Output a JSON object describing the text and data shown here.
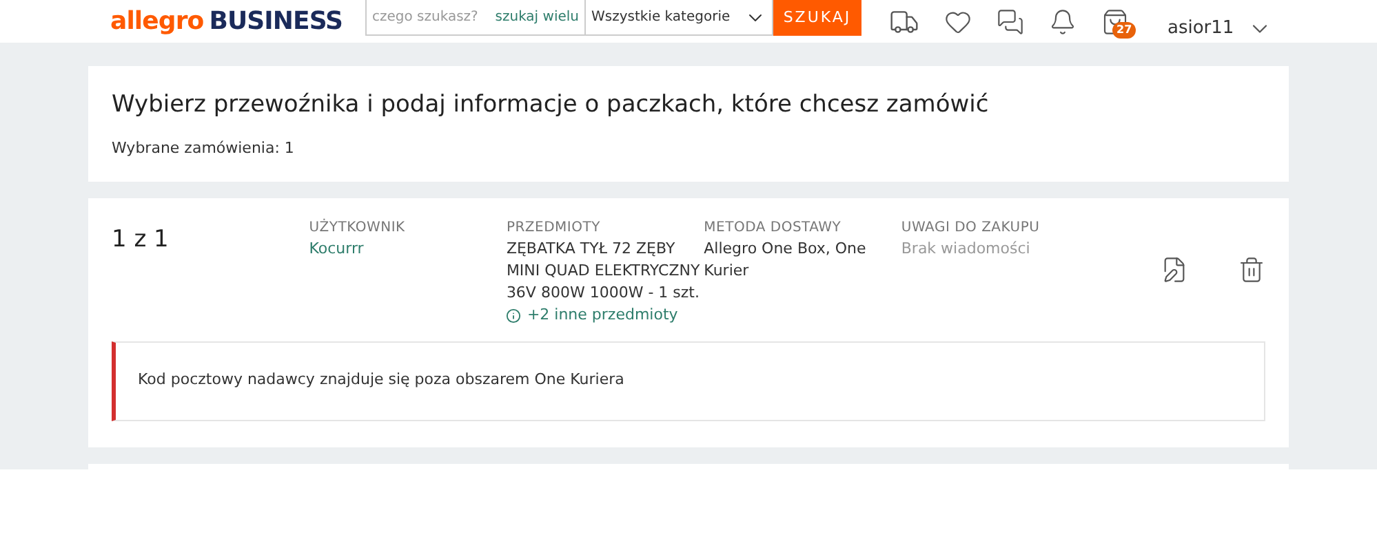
{
  "header": {
    "logo_left": "allegro",
    "logo_right": "BUSINESS",
    "search": {
      "placeholder": "czego szukasz?",
      "link": "szukaj wielu",
      "category": "Wszystkie kategorie",
      "button": "SZUKAJ"
    },
    "cart_badge": "27",
    "username": "asior11"
  },
  "intro": {
    "title": "Wybierz przewoźnika i podaj informacje o paczkach, które chcesz zamówić",
    "selected_orders": "Wybrane zamówienia: 1"
  },
  "order": {
    "counter": "1 z 1",
    "columns": [
      {
        "label": "UŻYTKOWNIK",
        "kind": "link",
        "lines": [
          "Kocurrr"
        ]
      },
      {
        "label": "PRZEDMIOTY",
        "kind": "items",
        "lines": [
          "ZĘBATKA TYŁ 72 ZĘBY MINI QUAD ELEKTRYCZNY 36V 800W 1000W - 1 szt."
        ],
        "more": "+2 inne przedmioty"
      },
      {
        "label": "METODA DOSTAWY",
        "kind": "text",
        "lines": [
          "Allegro One Box, One Kurier"
        ]
      },
      {
        "label": "UWAGI DO ZAKUPU",
        "kind": "muted",
        "lines": [
          "Brak wiadomości"
        ]
      }
    ],
    "alert": "Kod pocztowy nadawcy znajduje się poza obszarem One Kuriera"
  }
}
